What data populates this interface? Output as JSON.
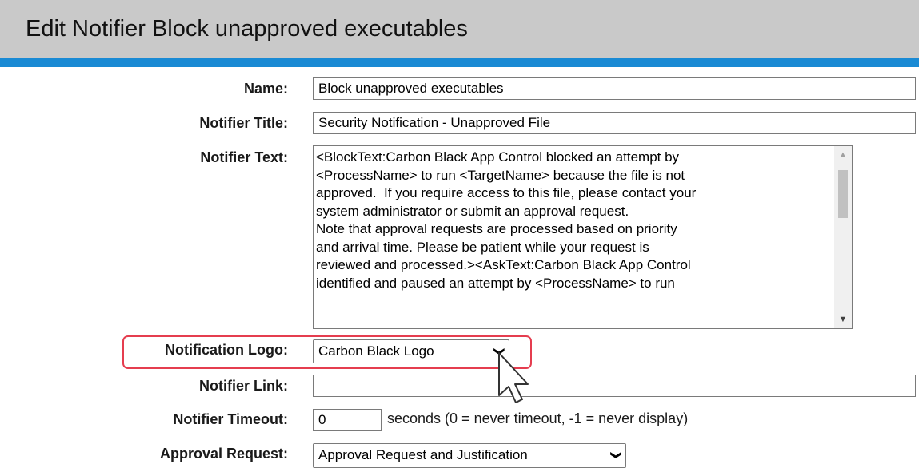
{
  "header": {
    "title": "Edit Notifier Block unapproved executables"
  },
  "fields": {
    "name": {
      "label": "Name:",
      "value": "Block unapproved executables"
    },
    "title": {
      "label": "Notifier Title:",
      "value": "Security Notification - Unapproved File"
    },
    "text": {
      "label": "Notifier Text:",
      "value": "<BlockText:Carbon Black App Control blocked an attempt by\n<ProcessName> to run <TargetName> because the file is not\napproved.  If you require access to this file, please contact your\nsystem administrator or submit an approval request.\nNote that approval requests are processed based on priority\nand arrival time. Please be patient while your request is\nreviewed and processed.><AskText:Carbon Black App Control\nidentified and paused an attempt by <ProcessName> to run"
    },
    "logo": {
      "label": "Notification Logo:",
      "selected": "Carbon Black Logo"
    },
    "link": {
      "label": "Notifier Link:",
      "value": ""
    },
    "timeout": {
      "label": "Notifier Timeout:",
      "value": "0",
      "suffix": "seconds (0 = never timeout, -1 = never display)"
    },
    "approval": {
      "label": "Approval Request:",
      "selected": "Approval Request and Justification"
    }
  },
  "icons": {
    "dropdown": "chevron-down-icon",
    "cursor": "mouse-pointer-icon",
    "scroll_up": "scroll-up-arrow-icon",
    "scroll_down": "scroll-down-arrow-icon"
  },
  "colors": {
    "header_bg": "#c9c9c9",
    "accent": "#1a8ad4",
    "highlight": "#e53d4f"
  }
}
